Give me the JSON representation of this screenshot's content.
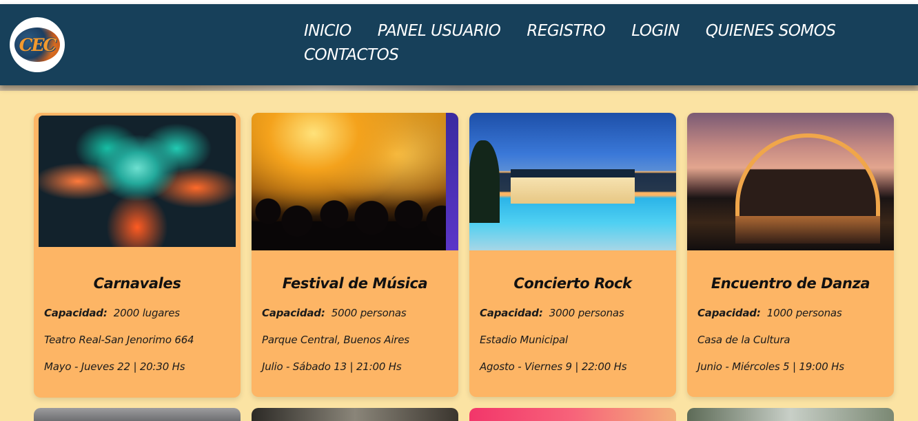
{
  "header": {
    "logo_text": "CEC",
    "nav": [
      {
        "label": "INICIO"
      },
      {
        "label": "PANEL USUARIO"
      },
      {
        "label": "REGISTRO"
      },
      {
        "label": "LOGIN"
      },
      {
        "label": "QUIENES SOMOS"
      },
      {
        "label": "CONTACTOS"
      }
    ]
  },
  "events": [
    {
      "title": "Carnavales",
      "capacity_label": "Capacidad:",
      "capacity_value": "2000 lugares",
      "place": "Teatro Real-San Jenorimo 664",
      "date": "Mayo - Jueves 22 | 20:30 Hs"
    },
    {
      "title": "Festival de Música",
      "capacity_label": "Capacidad:",
      "capacity_value": "5000 personas",
      "place": "Parque Central, Buenos Aires",
      "date": "Julio - Sábado 13 | 21:00 Hs"
    },
    {
      "title": "Concierto Rock",
      "capacity_label": "Capacidad:",
      "capacity_value": "3000 personas",
      "place": "Estadio Municipal",
      "date": "Agosto - Viernes 9 | 22:00 Hs"
    },
    {
      "title": "Encuentro de Danza",
      "capacity_label": "Capacidad:",
      "capacity_value": "1000 personas",
      "place": "Casa de la Cultura",
      "date": "Junio - Miércoles 5 | 19:00 Hs"
    }
  ],
  "colors": {
    "header_bg": "#17405a",
    "page_bg": "#fbe3a3",
    "card_bg": "#fdb565"
  }
}
